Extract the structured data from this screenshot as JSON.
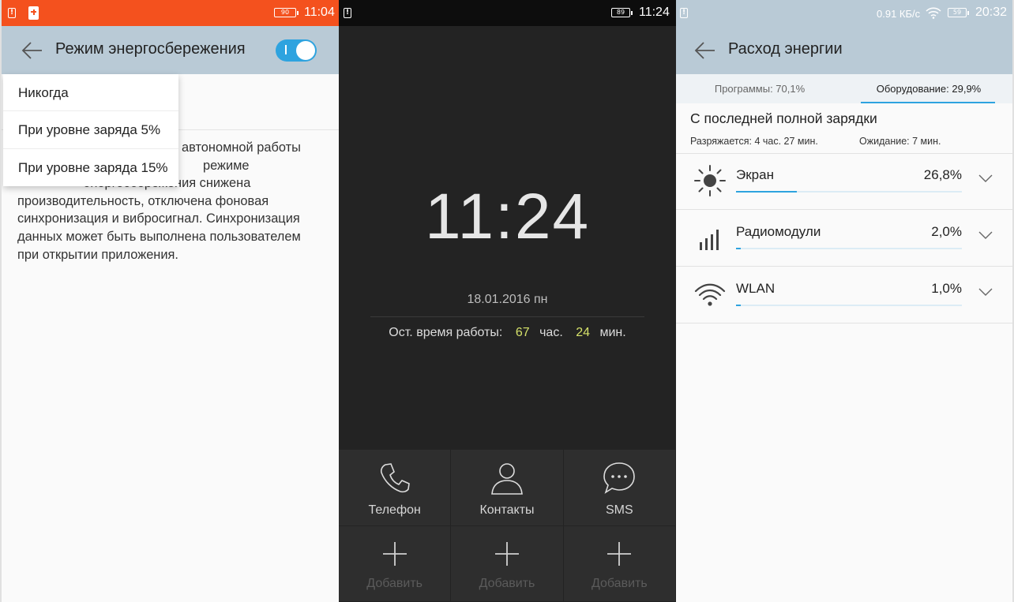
{
  "power_saving": {
    "status_bar": {
      "battery": "90",
      "time": "11:04"
    },
    "title": "Режим энергосбережения",
    "toggle_on": true,
    "dropdown": [
      "Никогда",
      "При уровне заряда 5%",
      "При уровне заряда 15%"
    ],
    "description": [
      "автономной работы",
      "режиме",
      "энергосбережения снижена",
      "производительность, отключена фоновая",
      "синхронизация и вибросигнал.  Синхронизация",
      "данных может быть выполнена пользователем",
      "при открытии приложения."
    ]
  },
  "home": {
    "status_bar": {
      "battery": "89",
      "time": "11:24"
    },
    "clock": "11:24",
    "date": "18.01.2016  пн",
    "remaining": {
      "label": "Ост. время работы:",
      "hours": "67",
      "hours_unit": "час.",
      "minutes": "24",
      "minutes_unit": "мин."
    },
    "apps": [
      {
        "label": "Телефон",
        "icon": "phone-icon"
      },
      {
        "label": "Контакты",
        "icon": "person-icon"
      },
      {
        "label": "SMS",
        "icon": "message-icon"
      }
    ],
    "add_label": "Добавить"
  },
  "usage": {
    "status_bar": {
      "speed": "0.91 КБ/с",
      "battery": "59",
      "time": "20:32"
    },
    "title": "Расход энергии",
    "tabs": [
      "Программы: 70,1%",
      "Оборудование: 29,9%"
    ],
    "active_tab": 1,
    "since_label": "С последней полной зарядки",
    "discharging": "Разряжается: 4 час. 27 мин.",
    "standby": "Ожидание: 7 мин.",
    "items": [
      {
        "name": "Экран",
        "percent": "26,8%",
        "fraction": 0.268,
        "icon": "sun-icon"
      },
      {
        "name": "Радиомодули",
        "percent": "2,0%",
        "fraction": 0.02,
        "icon": "signal-bars-icon"
      },
      {
        "name": "WLAN",
        "percent": "1,0%",
        "fraction": 0.01,
        "icon": "wifi-icon"
      }
    ]
  },
  "colors": {
    "accent": "#2ea3df",
    "orange_status": "#f4511e",
    "header_blue_gray": "#b9cad6",
    "highlight_yellow": "#d5e16a"
  }
}
